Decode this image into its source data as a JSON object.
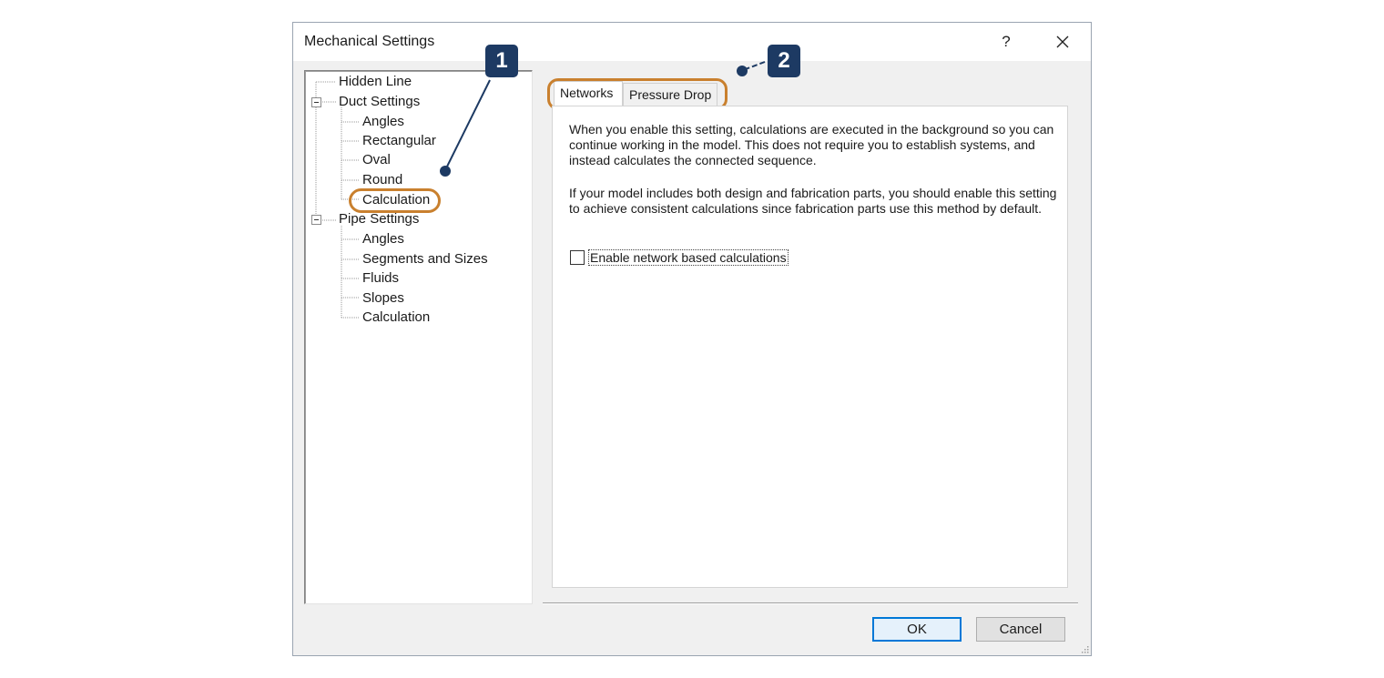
{
  "window": {
    "title": "Mechanical Settings",
    "help_label": "?",
    "close_icon": "close-icon"
  },
  "tree": {
    "items": [
      {
        "label": "Hidden Line",
        "level": 0
      },
      {
        "label": "Duct Settings",
        "level": 0,
        "expander": "collapse-icon"
      },
      {
        "label": "Angles",
        "level": 1
      },
      {
        "label": "Rectangular",
        "level": 1
      },
      {
        "label": "Oval",
        "level": 1
      },
      {
        "label": "Round",
        "level": 1
      },
      {
        "label": "Calculation",
        "level": 1,
        "selected": true
      },
      {
        "label": "Pipe Settings",
        "level": 0,
        "expander": "collapse-icon"
      },
      {
        "label": "Angles",
        "level": 1
      },
      {
        "label": "Segments and Sizes",
        "level": 1
      },
      {
        "label": "Fluids",
        "level": 1
      },
      {
        "label": "Slopes",
        "level": 1
      },
      {
        "label": "Calculation",
        "level": 1
      }
    ]
  },
  "tabs": [
    {
      "label": "Networks",
      "active": true
    },
    {
      "label": "Pressure Drop",
      "active": false
    }
  ],
  "networks": {
    "paragraph1": "When you enable this setting, calculations are executed in the background so you can continue working in the model. This does not require you to establish systems, and instead calculates the connected sequence.",
    "paragraph2": "If your model includes both design and fabrication parts, you should enable this setting to achieve consistent calculations since fabrication parts use this method by default.",
    "checkbox_label": "Enable network based calculations",
    "checkbox_checked": false
  },
  "buttons": {
    "ok": "OK",
    "cancel": "Cancel"
  },
  "callouts": [
    {
      "number": "1",
      "target": "tree-calculation"
    },
    {
      "number": "2",
      "target": "tabstrip"
    }
  ],
  "colors": {
    "callout_badge": "#1d3a63",
    "highlight_outline": "#c9802e",
    "default_button_border": "#0078d7"
  }
}
